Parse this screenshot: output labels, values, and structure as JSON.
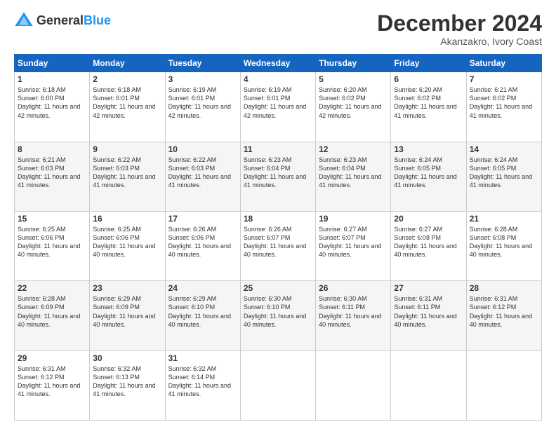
{
  "header": {
    "logo_general": "General",
    "logo_blue": "Blue",
    "month_title": "December 2024",
    "subtitle": "Akanzakro, Ivory Coast"
  },
  "days_of_week": [
    "Sunday",
    "Monday",
    "Tuesday",
    "Wednesday",
    "Thursday",
    "Friday",
    "Saturday"
  ],
  "weeks": [
    [
      {
        "day": "1",
        "sunrise": "6:18 AM",
        "sunset": "6:00 PM",
        "daylight": "11 hours and 42 minutes."
      },
      {
        "day": "2",
        "sunrise": "6:18 AM",
        "sunset": "6:01 PM",
        "daylight": "11 hours and 42 minutes."
      },
      {
        "day": "3",
        "sunrise": "6:19 AM",
        "sunset": "6:01 PM",
        "daylight": "11 hours and 42 minutes."
      },
      {
        "day": "4",
        "sunrise": "6:19 AM",
        "sunset": "6:01 PM",
        "daylight": "11 hours and 42 minutes."
      },
      {
        "day": "5",
        "sunrise": "6:20 AM",
        "sunset": "6:02 PM",
        "daylight": "11 hours and 42 minutes."
      },
      {
        "day": "6",
        "sunrise": "6:20 AM",
        "sunset": "6:02 PM",
        "daylight": "11 hours and 41 minutes."
      },
      {
        "day": "7",
        "sunrise": "6:21 AM",
        "sunset": "6:02 PM",
        "daylight": "11 hours and 41 minutes."
      }
    ],
    [
      {
        "day": "8",
        "sunrise": "6:21 AM",
        "sunset": "6:03 PM",
        "daylight": "11 hours and 41 minutes."
      },
      {
        "day": "9",
        "sunrise": "6:22 AM",
        "sunset": "6:03 PM",
        "daylight": "11 hours and 41 minutes."
      },
      {
        "day": "10",
        "sunrise": "6:22 AM",
        "sunset": "6:03 PM",
        "daylight": "11 hours and 41 minutes."
      },
      {
        "day": "11",
        "sunrise": "6:23 AM",
        "sunset": "6:04 PM",
        "daylight": "11 hours and 41 minutes."
      },
      {
        "day": "12",
        "sunrise": "6:23 AM",
        "sunset": "6:04 PM",
        "daylight": "11 hours and 41 minutes."
      },
      {
        "day": "13",
        "sunrise": "6:24 AM",
        "sunset": "6:05 PM",
        "daylight": "11 hours and 41 minutes."
      },
      {
        "day": "14",
        "sunrise": "6:24 AM",
        "sunset": "6:05 PM",
        "daylight": "11 hours and 41 minutes."
      }
    ],
    [
      {
        "day": "15",
        "sunrise": "6:25 AM",
        "sunset": "6:06 PM",
        "daylight": "11 hours and 40 minutes."
      },
      {
        "day": "16",
        "sunrise": "6:25 AM",
        "sunset": "6:06 PM",
        "daylight": "11 hours and 40 minutes."
      },
      {
        "day": "17",
        "sunrise": "6:26 AM",
        "sunset": "6:06 PM",
        "daylight": "11 hours and 40 minutes."
      },
      {
        "day": "18",
        "sunrise": "6:26 AM",
        "sunset": "6:07 PM",
        "daylight": "11 hours and 40 minutes."
      },
      {
        "day": "19",
        "sunrise": "6:27 AM",
        "sunset": "6:07 PM",
        "daylight": "11 hours and 40 minutes."
      },
      {
        "day": "20",
        "sunrise": "6:27 AM",
        "sunset": "6:08 PM",
        "daylight": "11 hours and 40 minutes."
      },
      {
        "day": "21",
        "sunrise": "6:28 AM",
        "sunset": "6:08 PM",
        "daylight": "11 hours and 40 minutes."
      }
    ],
    [
      {
        "day": "22",
        "sunrise": "6:28 AM",
        "sunset": "6:09 PM",
        "daylight": "11 hours and 40 minutes."
      },
      {
        "day": "23",
        "sunrise": "6:29 AM",
        "sunset": "6:09 PM",
        "daylight": "11 hours and 40 minutes."
      },
      {
        "day": "24",
        "sunrise": "6:29 AM",
        "sunset": "6:10 PM",
        "daylight": "11 hours and 40 minutes."
      },
      {
        "day": "25",
        "sunrise": "6:30 AM",
        "sunset": "6:10 PM",
        "daylight": "11 hours and 40 minutes."
      },
      {
        "day": "26",
        "sunrise": "6:30 AM",
        "sunset": "6:11 PM",
        "daylight": "11 hours and 40 minutes."
      },
      {
        "day": "27",
        "sunrise": "6:31 AM",
        "sunset": "6:11 PM",
        "daylight": "11 hours and 40 minutes."
      },
      {
        "day": "28",
        "sunrise": "6:31 AM",
        "sunset": "6:12 PM",
        "daylight": "11 hours and 40 minutes."
      }
    ],
    [
      {
        "day": "29",
        "sunrise": "6:31 AM",
        "sunset": "6:12 PM",
        "daylight": "11 hours and 41 minutes."
      },
      {
        "day": "30",
        "sunrise": "6:32 AM",
        "sunset": "6:13 PM",
        "daylight": "11 hours and 41 minutes."
      },
      {
        "day": "31",
        "sunrise": "6:32 AM",
        "sunset": "6:14 PM",
        "daylight": "11 hours and 41 minutes."
      },
      null,
      null,
      null,
      null
    ]
  ]
}
